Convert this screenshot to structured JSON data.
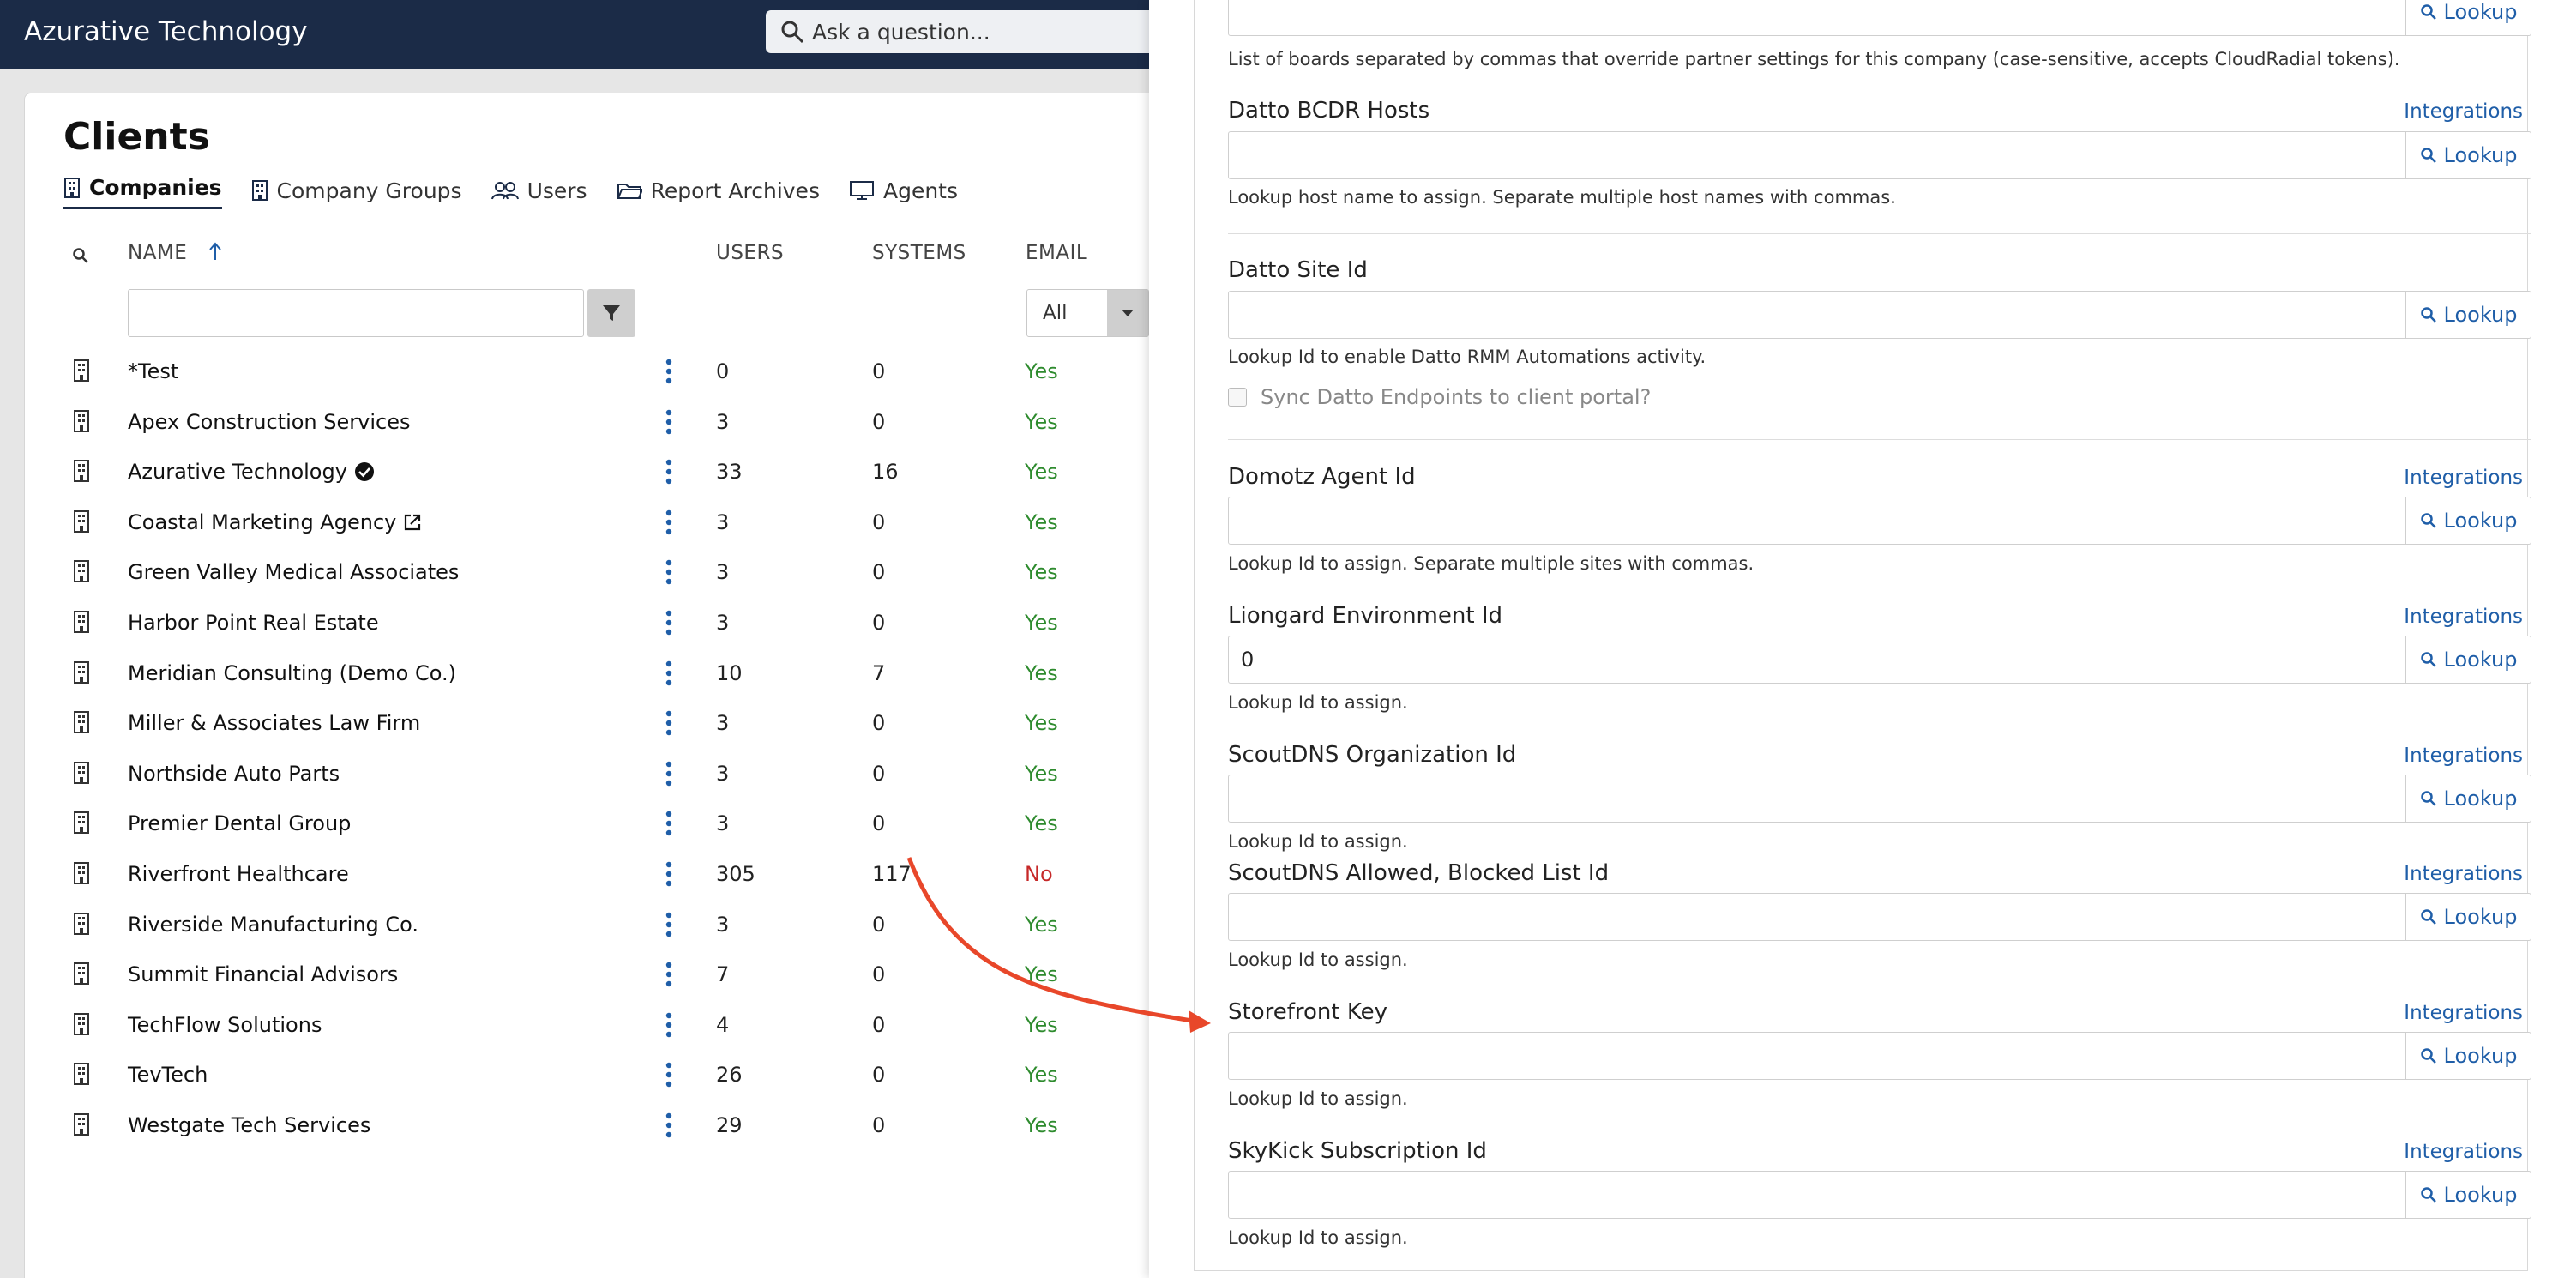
{
  "app": {
    "title": "Azurative Technology"
  },
  "search": {
    "placeholder": "Ask a question..."
  },
  "page": {
    "title": "Clients"
  },
  "tabs": [
    {
      "label": "Companies",
      "icon": "building-icon",
      "active": true
    },
    {
      "label": "Company Groups",
      "icon": "building-icon"
    },
    {
      "label": "Users",
      "icon": "users-icon"
    },
    {
      "label": "Report Archives",
      "icon": "folder-icon"
    },
    {
      "label": "Agents",
      "icon": "monitor-icon"
    }
  ],
  "table": {
    "headers": {
      "name": "NAME",
      "users": "USERS",
      "systems": "SYSTEMS",
      "email": "EMAIL"
    },
    "email_filter": "All",
    "rows": [
      {
        "name": "*Test",
        "users": "0",
        "systems": "0",
        "email": "Yes"
      },
      {
        "name": "Apex Construction Services",
        "users": "3",
        "systems": "0",
        "email": "Yes"
      },
      {
        "name": "Azurative Technology",
        "users": "33",
        "systems": "16",
        "email": "Yes"
      },
      {
        "name": "Coastal Marketing Agency",
        "users": "3",
        "systems": "0",
        "email": "Yes"
      },
      {
        "name": "Green Valley Medical Associates",
        "users": "3",
        "systems": "0",
        "email": "Yes"
      },
      {
        "name": "Harbor Point Real Estate",
        "users": "3",
        "systems": "0",
        "email": "Yes"
      },
      {
        "name": "Meridian Consulting (Demo Co.)",
        "users": "10",
        "systems": "7",
        "email": "Yes"
      },
      {
        "name": "Miller & Associates Law Firm",
        "users": "3",
        "systems": "0",
        "email": "Yes"
      },
      {
        "name": "Northside Auto Parts",
        "users": "3",
        "systems": "0",
        "email": "Yes"
      },
      {
        "name": "Premier Dental Group",
        "users": "3",
        "systems": "0",
        "email": "Yes"
      },
      {
        "name": "Riverfront Healthcare",
        "users": "305",
        "systems": "117",
        "email": "No"
      },
      {
        "name": "Riverside Manufacturing Co.",
        "users": "3",
        "systems": "0",
        "email": "Yes"
      },
      {
        "name": "Summit Financial Advisors",
        "users": "7",
        "systems": "0",
        "email": "Yes"
      },
      {
        "name": "TechFlow Solutions",
        "users": "4",
        "systems": "0",
        "email": "Yes"
      },
      {
        "name": "TevTech",
        "users": "26",
        "systems": "0",
        "email": "Yes"
      },
      {
        "name": "Westgate Tech Services",
        "users": "29",
        "systems": "0",
        "email": "Yes"
      }
    ]
  },
  "panel": {
    "lookup_label": "Lookup",
    "integrations_label": "Integrations",
    "boards_help": "List of boards separated by commas that override partner settings for this company (case-sensitive, accepts CloudRadial tokens).",
    "fields": {
      "datto_bcdr": {
        "label": "Datto BCDR Hosts",
        "value": "",
        "help": "Lookup host name to assign. Separate multiple host names with commas."
      },
      "datto_site": {
        "label": "Datto Site Id",
        "value": "",
        "help": "Lookup Id to enable Datto RMM Automations activity.",
        "checkbox": "Sync Datto Endpoints to client portal?"
      },
      "domotz": {
        "label": "Domotz Agent Id",
        "value": "",
        "help": "Lookup Id to assign. Separate multiple sites with commas."
      },
      "liongard": {
        "label": "Liongard Environment Id",
        "value": "0",
        "help": "Lookup Id to assign."
      },
      "scoutdns_org": {
        "label": "ScoutDNS Organization Id",
        "value": "",
        "help": "Lookup Id to assign."
      },
      "scoutdns_list": {
        "label": "ScoutDNS Allowed, Blocked List Id",
        "value": "",
        "help": "Lookup Id to assign."
      },
      "storefront": {
        "label": "Storefront Key",
        "value": "",
        "help": "Lookup Id to assign."
      },
      "skykick": {
        "label": "SkyKick Subscription Id",
        "value": "",
        "help": "Lookup Id to assign."
      }
    }
  },
  "colors": {
    "topbar": "#1b2b47",
    "link": "#1f5ea8",
    "yes": "#2e8b2e",
    "no": "#c62828",
    "arrow": "#e8472a"
  }
}
